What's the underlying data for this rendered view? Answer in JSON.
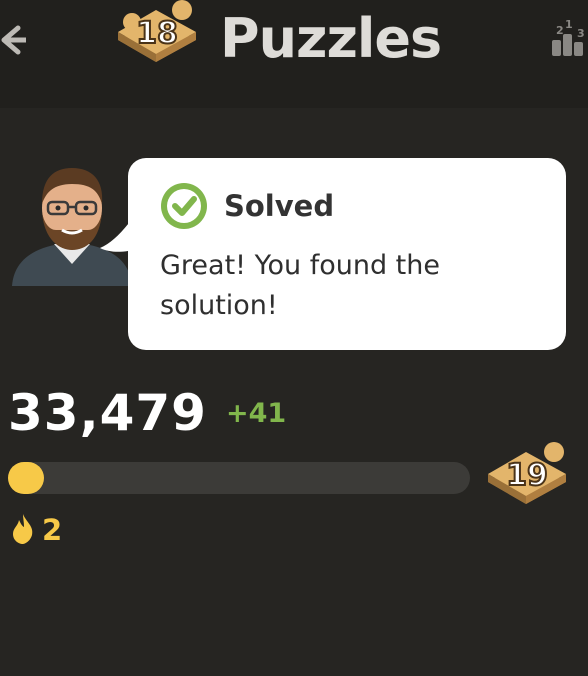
{
  "header": {
    "title": "Puzzles",
    "level_badge": "18",
    "back_icon": "arrow-left-icon",
    "leaderboard_icon": "leaderboard-icon"
  },
  "feedback": {
    "avatar": "coach-avatar",
    "status_icon": "check-circle-icon",
    "status": "Solved",
    "message": "Great! You found the solution!"
  },
  "rating": {
    "score": "33,479",
    "delta": "+41",
    "progress_fraction": 0.04,
    "next_level_badge": "19"
  },
  "streak": {
    "icon": "flame-icon",
    "count": "2"
  },
  "colors": {
    "background": "#262522",
    "header": "#21201d",
    "accent_green": "#81b64c",
    "progress_yellow": "#f7c948",
    "badge_gold": "#e3b56b"
  }
}
